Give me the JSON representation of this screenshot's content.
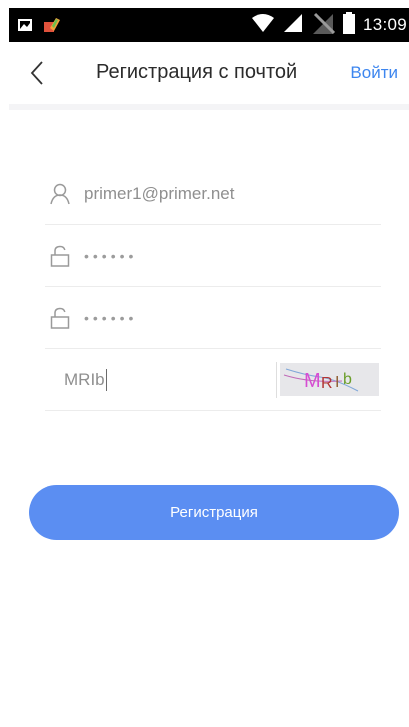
{
  "status_bar": {
    "time": "13:09",
    "icons": [
      "image-icon",
      "app-notification-icon",
      "wifi-icon",
      "signal-icon",
      "no-sim-icon",
      "battery-icon"
    ]
  },
  "header": {
    "title": "Регистрация с почтой",
    "login_link": "Войти",
    "back_icon": "chevron-left-icon"
  },
  "form": {
    "email": {
      "placeholder": "primer1@primer.net",
      "icon": "user-icon"
    },
    "password": {
      "value": "••••••",
      "icon": "lock-icon"
    },
    "password_confirm": {
      "value": "••••••",
      "icon": "lock-icon"
    },
    "captcha": {
      "value": "MRIb",
      "image_text": "MRIb"
    }
  },
  "register_button": {
    "label": "Регистрация"
  },
  "colors": {
    "accent": "#3d86ef",
    "button": "#5b8ef2",
    "status_bar": "#000000"
  }
}
